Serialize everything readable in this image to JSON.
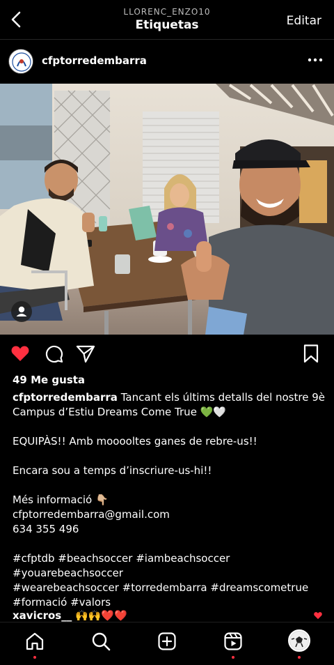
{
  "header": {
    "username": "LLORENC_ENZO10",
    "title": "Etiquetas",
    "edit_label": "Editar",
    "back_icon": "chevron-left-icon"
  },
  "post": {
    "username": "cfptorredembarra",
    "more_icon": "more-horizontal-icon",
    "likes": "49 Me gusta",
    "liked": true,
    "caption_lines": [
      "Tancant els últims detalls del nostre 9è",
      "Campus d’Estiu Dreams Come True 💚🤍",
      "",
      "EQUIPÀS!! Amb mooooltes ganes de rebre-us!!",
      "",
      "Encara sou a temps d’inscriure-us-hi!!",
      "",
      "Més informació 👇🏼",
      "cfptorredembarra@gmail.com",
      "634 355 496",
      "",
      "#cfptdb #beachsoccer #iambeachsoccer",
      "#youarebeachsoccer",
      "#wearebeachsoccer #torredembarra #dreamscometrue",
      "#formació #valors"
    ],
    "comment": {
      "username": "xavicros__",
      "text": "🙌🙌❤️❤️"
    }
  },
  "colors": {
    "like_red": "#ff3040",
    "background": "#000000",
    "muted_text": "#bdbdbd"
  },
  "nav": [
    "home-icon",
    "search-icon",
    "add-post-icon",
    "reels-icon",
    "profile-avatar"
  ]
}
